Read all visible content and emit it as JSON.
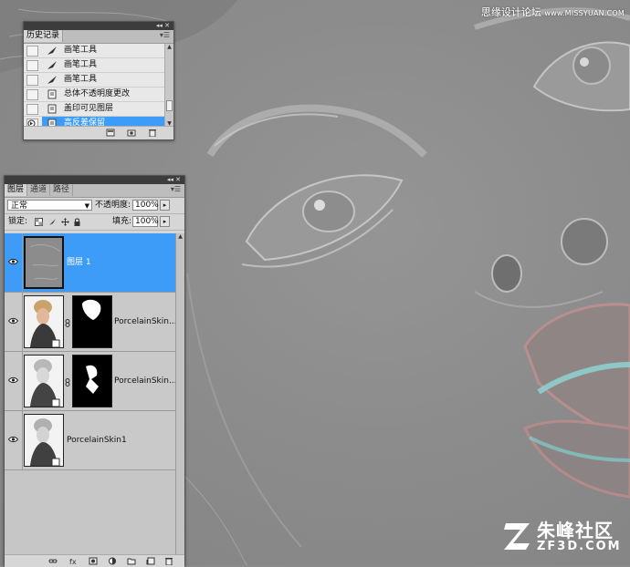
{
  "watermark": {
    "text": "思缘设计论坛",
    "site": "www.MISSYUAN.COM"
  },
  "logo": {
    "name_cn": "朱峰社区",
    "name_en": "ZF3D.COM"
  },
  "history_panel": {
    "tab": "历史记录",
    "items": [
      {
        "label": "画笔工具",
        "icon": "brush-icon"
      },
      {
        "label": "画笔工具",
        "icon": "brush-icon"
      },
      {
        "label": "画笔工具",
        "icon": "brush-icon"
      },
      {
        "label": "总体不透明度更改",
        "icon": "history-state-icon"
      },
      {
        "label": "盖印可见图层",
        "icon": "history-state-icon"
      },
      {
        "label": "高反差保留",
        "icon": "history-state-icon",
        "selected": true
      }
    ]
  },
  "layers_panel": {
    "tabs": [
      "图层",
      "通道",
      "路径"
    ],
    "blend_mode": "正常",
    "opacity_label": "不透明度:",
    "opacity_value": "100%",
    "lock_label": "锁定:",
    "fill_label": "填充:",
    "fill_value": "100%",
    "layers": [
      {
        "name": "图层 1",
        "selected": true,
        "has_mask": false
      },
      {
        "name": "PorcelainSkin...",
        "selected": false,
        "has_mask": true
      },
      {
        "name": "PorcelainSkin...",
        "selected": false,
        "has_mask": true
      },
      {
        "name": "PorcelainSkin1",
        "selected": false,
        "has_mask": false
      }
    ]
  },
  "colors": {
    "selection": "#3d9cf7",
    "panel_bg": "#d6d6d6",
    "titlebar": "#3c3c3c",
    "canvas": "#8c8c8c"
  }
}
